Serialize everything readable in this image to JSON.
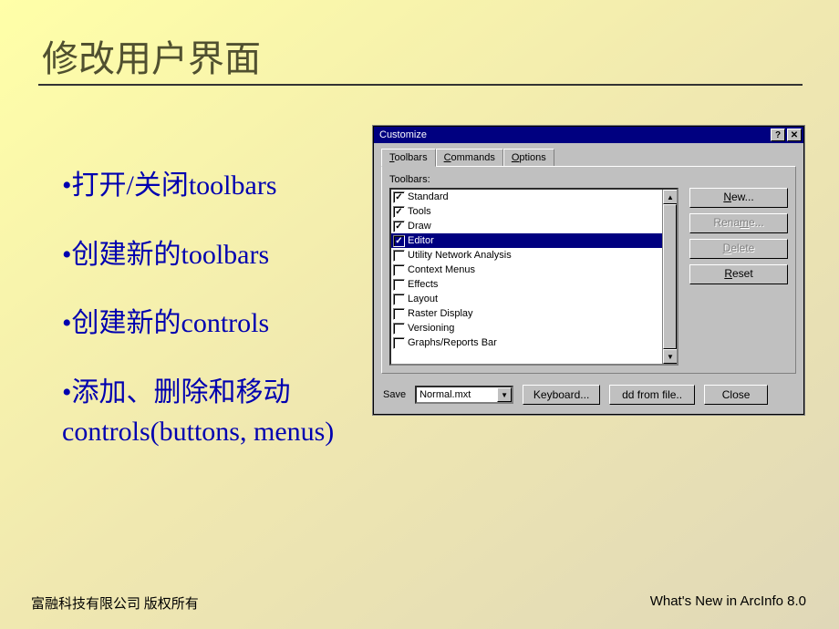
{
  "slide": {
    "title": "修改用户界面",
    "bullets": [
      "打开/关闭toolbars",
      "创建新的toolbars",
      "创建新的controls",
      "添加、删除和移动controls(buttons, menus)"
    ]
  },
  "dialog": {
    "title": "Customize",
    "tabs": [
      "Toolbars",
      "Commands",
      "Options"
    ],
    "activeTab": 0,
    "toolbarsLabel": "Toolbars:",
    "toolbars": [
      {
        "label": "Standard",
        "checked": true,
        "selected": false
      },
      {
        "label": "Tools",
        "checked": true,
        "selected": false
      },
      {
        "label": "Draw",
        "checked": true,
        "selected": false
      },
      {
        "label": "Editor",
        "checked": true,
        "selected": true
      },
      {
        "label": "Utility Network Analysis",
        "checked": false,
        "selected": false
      },
      {
        "label": "Context Menus",
        "checked": false,
        "selected": false
      },
      {
        "label": "Effects",
        "checked": false,
        "selected": false
      },
      {
        "label": "Layout",
        "checked": false,
        "selected": false
      },
      {
        "label": "Raster Display",
        "checked": false,
        "selected": false
      },
      {
        "label": "Versioning",
        "checked": false,
        "selected": false
      },
      {
        "label": "Graphs/Reports Bar",
        "checked": false,
        "selected": false
      }
    ],
    "sideButtons": {
      "new": "New...",
      "rename": "Rename...",
      "delete": "Delete",
      "reset": "Reset"
    },
    "bottom": {
      "saveLabel": "Save",
      "comboValue": "Normal.mxt",
      "keyboard": "Keyboard...",
      "addFromFile": "dd from file..",
      "close": "Close"
    }
  },
  "footer": {
    "left": "富融科技有限公司 版权所有",
    "right": "What's New in ArcInfo 8.0"
  }
}
